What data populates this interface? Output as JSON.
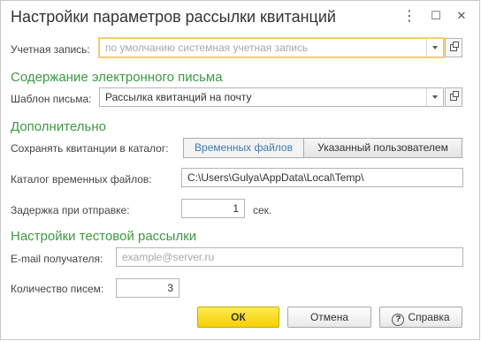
{
  "window": {
    "title": "Настройки параметров рассылки квитанций",
    "controls": {
      "more": "⋮",
      "maximize": "☐",
      "close": "✕"
    }
  },
  "account": {
    "label": "Учетная запись:",
    "placeholder": "по умолчанию системная учетная запись"
  },
  "content_section": {
    "heading": "Содержание электронного письма",
    "template_label": "Шаблон письма:",
    "template_value": "Рассылка квитанций на почту"
  },
  "extra_section": {
    "heading": "Дополнительно",
    "save_label": "Сохранять квитанции в каталог:",
    "save_options": [
      "Временных файлов",
      "Указанный пользователем"
    ],
    "save_selected": "Временных файлов",
    "temp_dir_label": "Каталог временных файлов:",
    "temp_dir_value": "C:\\Users\\Gulya\\AppData\\Local\\Temp\\",
    "delay_label": "Задержка при отправке:",
    "delay_value": "1",
    "delay_unit": "сек."
  },
  "test_section": {
    "heading": "Настройки тестовой рассылки",
    "email_label": "E-mail получателя:",
    "email_placeholder": "example@server.ru",
    "count_label": "Количество писем:",
    "count_value": "3"
  },
  "footer": {
    "ok": "ОК",
    "cancel": "Отмена",
    "help": "Справка",
    "help_icon": "?"
  },
  "colors": {
    "section_heading": "#3d9a41",
    "focus_border": "#efc84a",
    "primary_button": "#f5cf00",
    "active_segment_text": "#3d7ab5"
  }
}
